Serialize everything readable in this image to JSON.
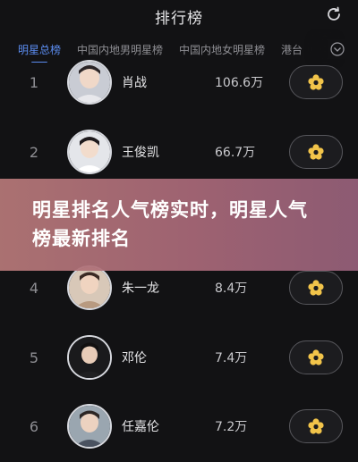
{
  "header": {
    "title": "排行榜",
    "refresh_icon": "refresh-icon"
  },
  "tabs": [
    {
      "label": "明星总榜",
      "active": true
    },
    {
      "label": "中国内地男明星榜",
      "active": false
    },
    {
      "label": "中国内地女明星榜",
      "active": false
    },
    {
      "label": "港台",
      "active": false
    }
  ],
  "rows": [
    {
      "rank": "1",
      "name": "肖战",
      "score": "106.6万"
    },
    {
      "rank": "2",
      "name": "王俊凯",
      "score": "66.7万"
    },
    {
      "rank": "4",
      "name": "朱一龙",
      "score": "8.4万"
    },
    {
      "rank": "5",
      "name": "邓伦",
      "score": "7.4万"
    },
    {
      "rank": "6",
      "name": "任嘉伦",
      "score": "7.2万"
    }
  ],
  "vote_icon": "flower-vote-icon",
  "banner": {
    "text": "明星排名人气榜实时，明星人气榜最新排名"
  },
  "colors": {
    "accent": "#5b8cf0",
    "background": "#121214",
    "banner": "#b07878",
    "vote": "#f2c44a"
  }
}
